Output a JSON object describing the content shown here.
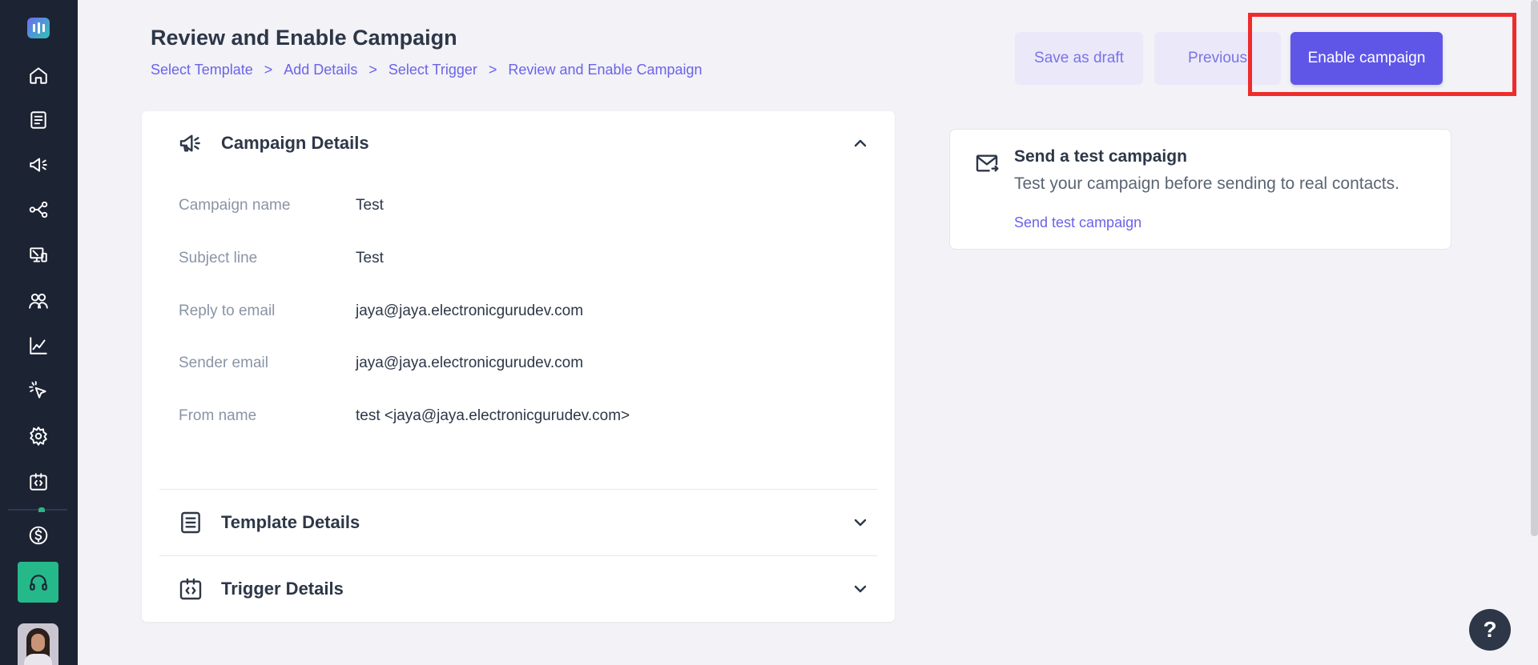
{
  "sidebar": {
    "items": [
      {
        "icon": "home-icon"
      },
      {
        "icon": "templates-icon"
      },
      {
        "icon": "campaigns-icon"
      },
      {
        "icon": "workflow-icon"
      },
      {
        "icon": "web-forms-icon"
      },
      {
        "icon": "contacts-icon"
      },
      {
        "icon": "analytics-icon"
      },
      {
        "icon": "click-tracking-icon"
      },
      {
        "icon": "settings-icon"
      },
      {
        "icon": "integrations-icon"
      }
    ],
    "bottom": [
      {
        "icon": "billing-icon"
      },
      {
        "icon": "support-headset-icon"
      },
      {
        "icon": "user-avatar"
      }
    ]
  },
  "header": {
    "title": "Review and Enable Campaign",
    "breadcrumb": [
      "Select Template",
      "Add Details",
      "Select Trigger",
      "Review and Enable Campaign"
    ],
    "separator": ">"
  },
  "actions": {
    "save_draft": "Save as draft",
    "previous": "Previous",
    "enable": "Enable campaign"
  },
  "campaign_details": {
    "title": "Campaign Details",
    "expanded": true,
    "rows": [
      {
        "label": "Campaign name",
        "value": "Test"
      },
      {
        "label": "Subject line",
        "value": "Test"
      },
      {
        "label": "Reply to email",
        "value": "jaya@jaya.electronicgurudev.com"
      },
      {
        "label": "Sender email",
        "value": "jaya@jaya.electronicgurudev.com"
      },
      {
        "label": "From name",
        "value": "test <jaya@jaya.electronicgurudev.com>"
      }
    ]
  },
  "template_details": {
    "title": "Template Details",
    "expanded": false
  },
  "trigger_details": {
    "title": "Trigger Details",
    "expanded": false
  },
  "test_campaign": {
    "title": "Send a test campaign",
    "description": "Test your campaign before sending to real contacts.",
    "link": "Send test campaign"
  },
  "help": {
    "label": "?"
  },
  "colors": {
    "accent": "#5f56e8",
    "sidebar_bg": "#1c2333",
    "support_green": "#25b98a",
    "highlight_red": "#ef2b2b"
  }
}
